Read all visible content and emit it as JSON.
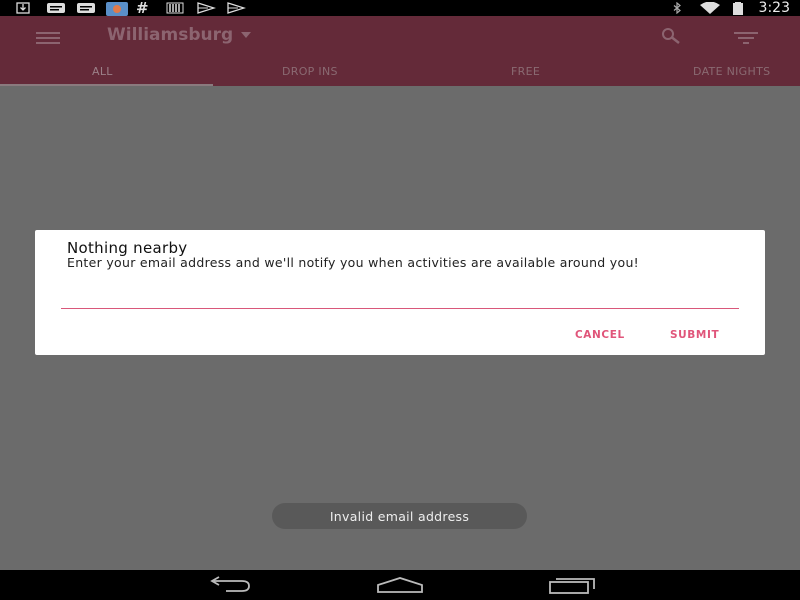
{
  "status_bar": {
    "time": "3:23",
    "left_icons": [
      "download-icon",
      "message-icon",
      "message-icon",
      "app-icon",
      "hashtag-icon",
      "barcode-icon",
      "play-store-icon",
      "play-store-icon"
    ],
    "right_icons": [
      "bluetooth-icon",
      "wifi-icon",
      "battery-icon"
    ]
  },
  "app_bar": {
    "location": "Williamsburg",
    "tabs": [
      "ALL",
      "DROP INS",
      "FREE",
      "DATE NIGHTS"
    ],
    "selected_tab": "ALL",
    "brand_color": "#642a39"
  },
  "dialog": {
    "title": "Nothing nearby",
    "message": "Enter your email address and we'll notify you when activities are available around you!",
    "email_value": "",
    "cancel_label": "CANCEL",
    "submit_label": "SUBMIT",
    "accent_color": "#e0557a"
  },
  "toast": {
    "text": "Invalid email address"
  }
}
